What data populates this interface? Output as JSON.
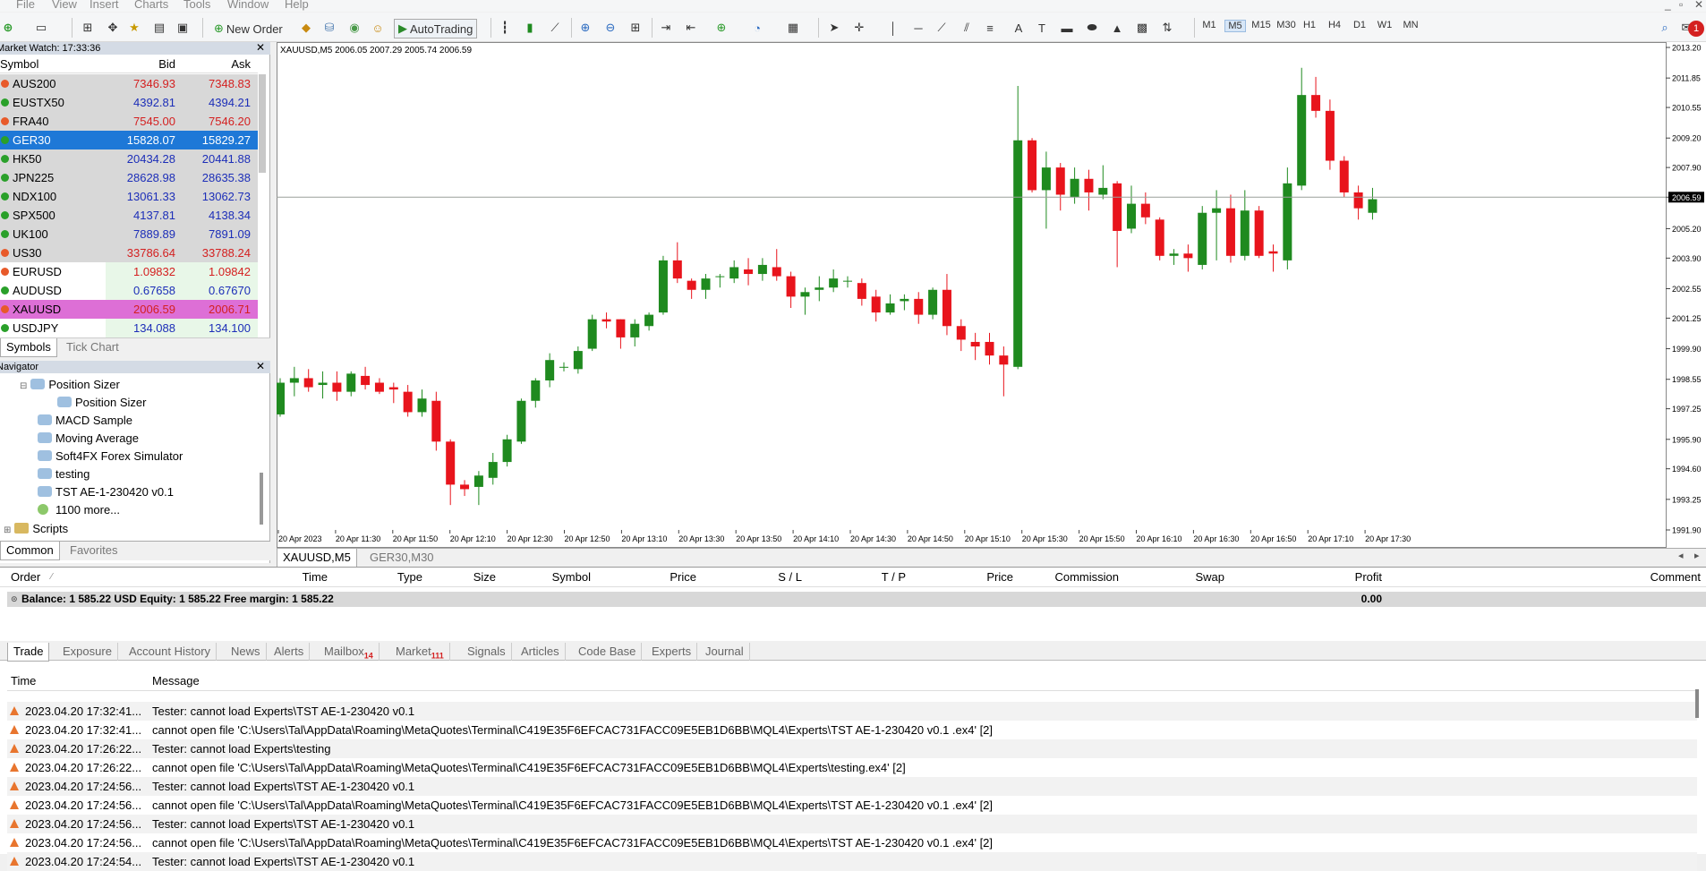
{
  "menu": [
    "File",
    "View",
    "Insert",
    "Charts",
    "Tools",
    "Window",
    "Help"
  ],
  "toolbar": {
    "new_order": "New Order",
    "autotrading": "AutoTrading",
    "timeframes": [
      "M1",
      "M5",
      "M15",
      "M30",
      "H1",
      "H4",
      "D1",
      "W1",
      "MN"
    ],
    "active_timeframe": "M5",
    "notifications": "1"
  },
  "market_watch": {
    "title": "Market Watch: 17:33:36",
    "headers": {
      "symbol": "Symbol",
      "bid": "Bid",
      "ask": "Ask"
    },
    "rows": [
      {
        "symbol": "AUS200",
        "bid": "7346.93",
        "ask": "7348.83",
        "dir": "down"
      },
      {
        "symbol": "EUSTX50",
        "bid": "4392.81",
        "ask": "4394.21",
        "dir": "up"
      },
      {
        "symbol": "FRA40",
        "bid": "7545.00",
        "ask": "7546.20",
        "dir": "down"
      },
      {
        "symbol": "GER30",
        "bid": "15828.07",
        "ask": "15829.27",
        "dir": "up"
      },
      {
        "symbol": "HK50",
        "bid": "20434.28",
        "ask": "20441.88",
        "dir": "up"
      },
      {
        "symbol": "JPN225",
        "bid": "28628.98",
        "ask": "28635.38",
        "dir": "up"
      },
      {
        "symbol": "NDX100",
        "bid": "13061.33",
        "ask": "13062.73",
        "dir": "up"
      },
      {
        "symbol": "SPX500",
        "bid": "4137.81",
        "ask": "4138.34",
        "dir": "up"
      },
      {
        "symbol": "UK100",
        "bid": "7889.89",
        "ask": "7891.09",
        "dir": "up"
      },
      {
        "symbol": "US30",
        "bid": "33786.64",
        "ask": "33788.24",
        "dir": "down"
      },
      {
        "symbol": "EURUSD",
        "bid": "1.09832",
        "ask": "1.09842",
        "dir": "down"
      },
      {
        "symbol": "AUDUSD",
        "bid": "0.67658",
        "ask": "0.67670",
        "dir": "up"
      },
      {
        "symbol": "XAUUSD",
        "bid": "2006.59",
        "ask": "2006.71",
        "dir": "down"
      },
      {
        "symbol": "USDJPY",
        "bid": "134.088",
        "ask": "134.100",
        "dir": "up"
      }
    ],
    "tabs": [
      "Symbols",
      "Tick Chart"
    ]
  },
  "navigator": {
    "title": "Navigator",
    "items": [
      "Position Sizer",
      "Position Sizer",
      "MACD Sample",
      "Moving Average",
      "Soft4FX Forex Simulator",
      "testing",
      "TST AE-1-230420 v0.1",
      "1100 more...",
      "Scripts"
    ],
    "tabs": [
      "Common",
      "Favorites"
    ]
  },
  "chart": {
    "header": "XAUUSD,M5  2006.05 2007.29 2005.74 2006.59",
    "current_price": "2006.59",
    "tabs": [
      "XAUUSD,M5",
      "GER30,M30"
    ],
    "time_labels": [
      "20 Apr 2023",
      "20 Apr 11:30",
      "20 Apr 11:50",
      "20 Apr 12:10",
      "20 Apr 12:30",
      "20 Apr 12:50",
      "20 Apr 13:10",
      "20 Apr 13:30",
      "20 Apr 13:50",
      "20 Apr 14:10",
      "20 Apr 14:30",
      "20 Apr 14:50",
      "20 Apr 15:10",
      "20 Apr 15:30",
      "20 Apr 15:50",
      "20 Apr 16:10",
      "20 Apr 16:30",
      "20 Apr 16:50",
      "20 Apr 17:10",
      "20 Apr 17:30"
    ],
    "price_labels": [
      "2013.20",
      "2011.85",
      "2010.55",
      "2009.20",
      "2007.90",
      "2006.59",
      "2005.20",
      "2003.90",
      "2002.55",
      "2001.25",
      "1999.90",
      "1998.55",
      "1997.25",
      "1995.90",
      "1994.60",
      "1993.25",
      "1991.90"
    ],
    "colors": {
      "bull": "#1f8a1f",
      "bear": "#e8141c",
      "grid": "#d0d0d0"
    }
  },
  "chart_data": {
    "type": "candlestick",
    "ylim": [
      1991.9,
      2013.2
    ],
    "candles": [
      [
        1997.0,
        1998.6,
        1996.9,
        1998.4
      ],
      [
        1998.4,
        1999.1,
        1997.8,
        1998.6
      ],
      [
        1998.6,
        1999.0,
        1998.0,
        1998.2
      ],
      [
        1998.3,
        1998.9,
        1997.7,
        1998.4
      ],
      [
        1998.4,
        1998.9,
        1997.6,
        1998.0
      ],
      [
        1998.0,
        1998.9,
        1997.8,
        1998.8
      ],
      [
        1998.7,
        1999.1,
        1998.1,
        1998.3
      ],
      [
        1998.4,
        1998.6,
        1997.9,
        1998.0
      ],
      [
        1998.2,
        1998.4,
        1997.5,
        1998.1
      ],
      [
        1998.0,
        1998.3,
        1996.9,
        1997.1
      ],
      [
        1997.1,
        1998.1,
        1996.9,
        1997.7
      ],
      [
        1997.6,
        1998.0,
        1995.4,
        1995.8
      ],
      [
        1995.8,
        1995.9,
        1993.0,
        1993.9
      ],
      [
        1993.9,
        1994.1,
        1993.4,
        1993.7
      ],
      [
        1993.8,
        1994.5,
        1993.0,
        1994.3
      ],
      [
        1994.2,
        1995.3,
        1993.9,
        1994.9
      ],
      [
        1994.9,
        1996.1,
        1994.7,
        1995.9
      ],
      [
        1995.8,
        1997.7,
        1995.7,
        1997.6
      ],
      [
        1997.6,
        1998.6,
        1997.3,
        1998.5
      ],
      [
        1998.5,
        1999.7,
        1998.2,
        1999.4
      ],
      [
        1999.1,
        1999.3,
        1998.9,
        1999.1
      ],
      [
        1999.0,
        2000.0,
        1998.8,
        1999.8
      ],
      [
        1999.9,
        2001.4,
        1999.8,
        2001.2
      ],
      [
        2001.2,
        2001.5,
        2000.8,
        2001.1
      ],
      [
        2001.2,
        2001.2,
        1999.9,
        2000.4
      ],
      [
        2000.4,
        2001.2,
        2000.0,
        2001.0
      ],
      [
        2000.9,
        2001.5,
        2000.7,
        2001.4
      ],
      [
        2001.5,
        2004.0,
        2001.4,
        2003.8
      ],
      [
        2003.8,
        2004.6,
        2002.8,
        2003.0
      ],
      [
        2002.9,
        2003.0,
        2002.1,
        2002.5
      ],
      [
        2002.5,
        2003.2,
        2002.1,
        2003.0
      ],
      [
        2003.1,
        2003.2,
        2002.6,
        2003.1
      ],
      [
        2003.0,
        2003.8,
        2002.8,
        2003.5
      ],
      [
        2003.4,
        2003.9,
        2002.7,
        2003.2
      ],
      [
        2003.2,
        2003.9,
        2002.9,
        2003.6
      ],
      [
        2003.5,
        2004.3,
        2002.9,
        2003.1
      ],
      [
        2003.1,
        2003.3,
        2001.7,
        2002.2
      ],
      [
        2002.2,
        2002.6,
        2001.4,
        2002.4
      ],
      [
        2002.5,
        2003.1,
        2002.0,
        2002.6
      ],
      [
        2002.6,
        2003.4,
        2002.4,
        2003.0
      ],
      [
        2002.9,
        2003.1,
        2002.6,
        2002.9
      ],
      [
        2002.8,
        2003.0,
        2001.8,
        2002.1
      ],
      [
        2002.2,
        2002.5,
        2001.1,
        2001.5
      ],
      [
        2001.5,
        2002.3,
        2001.4,
        2001.9
      ],
      [
        2002.0,
        2002.3,
        2001.6,
        2002.1
      ],
      [
        2002.1,
        2002.4,
        2001.0,
        2001.4
      ],
      [
        2001.4,
        2002.6,
        2001.2,
        2002.5
      ],
      [
        2002.5,
        2003.2,
        2000.5,
        2000.9
      ],
      [
        2000.9,
        2001.2,
        1999.8,
        2000.3
      ],
      [
        2000.2,
        2000.6,
        1999.4,
        2000.0
      ],
      [
        2000.2,
        2000.6,
        1999.2,
        1999.6
      ],
      [
        1999.6,
        2000.0,
        1997.8,
        1999.2
      ],
      [
        1999.1,
        2011.5,
        1999.0,
        2009.1
      ],
      [
        2009.1,
        2009.2,
        2006.8,
        2006.9
      ],
      [
        2006.9,
        2008.6,
        2005.2,
        2007.9
      ],
      [
        2007.9,
        2008.1,
        2006.0,
        2006.7
      ],
      [
        2006.6,
        2007.9,
        2006.3,
        2007.4
      ],
      [
        2007.4,
        2007.8,
        2006.0,
        2006.8
      ],
      [
        2006.7,
        2008.0,
        2006.5,
        2007.0
      ],
      [
        2007.2,
        2007.3,
        2003.5,
        2005.1
      ],
      [
        2005.2,
        2007.1,
        2005.0,
        2006.3
      ],
      [
        2006.3,
        2006.8,
        2005.4,
        2005.7
      ],
      [
        2005.6,
        2005.7,
        2003.8,
        2004.0
      ],
      [
        2004.0,
        2004.3,
        2003.6,
        2004.1
      ],
      [
        2004.1,
        2004.5,
        2003.3,
        2003.9
      ],
      [
        2003.6,
        2006.2,
        2003.4,
        2005.9
      ],
      [
        2005.9,
        2006.9,
        2003.8,
        2006.1
      ],
      [
        2006.1,
        2006.7,
        2003.7,
        2004.0
      ],
      [
        2004.0,
        2006.9,
        2003.8,
        2006.0
      ],
      [
        2006.0,
        2006.2,
        2003.9,
        2004.0
      ],
      [
        2004.2,
        2004.5,
        2003.3,
        2004.1
      ],
      [
        2003.8,
        2007.9,
        2003.4,
        2007.2
      ],
      [
        2007.1,
        2012.3,
        2006.9,
        2011.1
      ],
      [
        2011.1,
        2011.9,
        2010.1,
        2010.4
      ],
      [
        2010.4,
        2010.9,
        2007.8,
        2008.2
      ],
      [
        2008.2,
        2008.4,
        2006.6,
        2006.8
      ],
      [
        2006.8,
        2007.1,
        2005.6,
        2006.1
      ],
      [
        2005.9,
        2007.0,
        2005.6,
        2006.5
      ]
    ]
  },
  "terminal": {
    "headers": [
      "Order",
      "Time",
      "Type",
      "Size",
      "Symbol",
      "Price",
      "S / L",
      "T / P",
      "Price",
      "Commission",
      "Swap",
      "Profit",
      "Comment"
    ],
    "balance_line": "Balance: 1 585.22 USD  Equity: 1 585.22  Free margin: 1 585.22",
    "profit": "0.00",
    "tabs": [
      {
        "label": "Trade",
        "badge": ""
      },
      {
        "label": "Exposure",
        "badge": ""
      },
      {
        "label": "Account History",
        "badge": ""
      },
      {
        "label": "News",
        "badge": ""
      },
      {
        "label": "Alerts",
        "badge": ""
      },
      {
        "label": "Mailbox",
        "badge": "14"
      },
      {
        "label": "Market",
        "badge": "111"
      },
      {
        "label": "Signals",
        "badge": ""
      },
      {
        "label": "Articles",
        "badge": ""
      },
      {
        "label": "Code Base",
        "badge": ""
      },
      {
        "label": "Experts",
        "badge": ""
      },
      {
        "label": "Journal",
        "badge": ""
      }
    ],
    "log_headers": {
      "time": "Time",
      "message": "Message"
    },
    "log": [
      {
        "time": "2023.04.20 17:32:41....",
        "message": "Tester: cannot load Experts\\TST AE-1-230420 v0.1"
      },
      {
        "time": "2023.04.20 17:32:41....",
        "message": "cannot open file 'C:\\Users\\Tal\\AppData\\Roaming\\MetaQuotes\\Terminal\\C419E35F6EFCAC731FACC09E5EB1D6BB\\MQL4\\Experts\\TST AE-1-230420 v0.1 .ex4' [2]"
      },
      {
        "time": "2023.04.20 17:26:22....",
        "message": "Tester: cannot load Experts\\testing"
      },
      {
        "time": "2023.04.20 17:26:22....",
        "message": "cannot open file 'C:\\Users\\Tal\\AppData\\Roaming\\MetaQuotes\\Terminal\\C419E35F6EFCAC731FACC09E5EB1D6BB\\MQL4\\Experts\\testing.ex4' [2]"
      },
      {
        "time": "2023.04.20 17:24:56....",
        "message": "Tester: cannot load Experts\\TST AE-1-230420 v0.1"
      },
      {
        "time": "2023.04.20 17:24:56....",
        "message": "cannot open file 'C:\\Users\\Tal\\AppData\\Roaming\\MetaQuotes\\Terminal\\C419E35F6EFCAC731FACC09E5EB1D6BB\\MQL4\\Experts\\TST AE-1-230420 v0.1 .ex4' [2]"
      },
      {
        "time": "2023.04.20 17:24:56....",
        "message": "Tester: cannot load Experts\\TST AE-1-230420 v0.1"
      },
      {
        "time": "2023.04.20 17:24:56....",
        "message": "cannot open file 'C:\\Users\\Tal\\AppData\\Roaming\\MetaQuotes\\Terminal\\C419E35F6EFCAC731FACC09E5EB1D6BB\\MQL4\\Experts\\TST AE-1-230420 v0.1 .ex4' [2]"
      },
      {
        "time": "2023.04.20 17:24:54....",
        "message": "Tester: cannot load Experts\\TST AE-1-230420 v0.1"
      }
    ]
  }
}
